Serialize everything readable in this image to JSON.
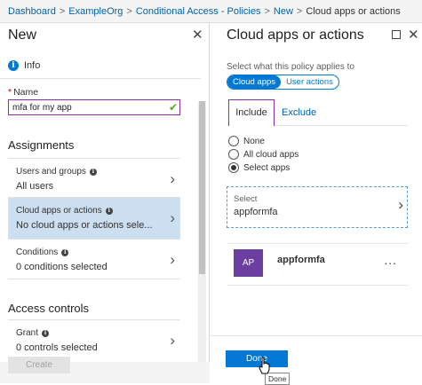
{
  "breadcrumb": [
    "Dashboard",
    "ExampleOrg",
    "Conditional Access - Policies",
    "New",
    "Cloud apps or actions"
  ],
  "left_blade": {
    "title": "New",
    "info_label": "Info",
    "name_label": "Name",
    "name_value": "mfa for my app",
    "assignments_heading": "Assignments",
    "items": [
      {
        "label": "Users and groups",
        "value": "All users"
      },
      {
        "label": "Cloud apps or actions",
        "value": "No cloud apps or actions sele..."
      },
      {
        "label": "Conditions",
        "value": "0 conditions selected"
      }
    ],
    "access_heading": "Access controls",
    "grant": {
      "label": "Grant",
      "value": "0 controls selected"
    },
    "create_label": "Create"
  },
  "right_blade": {
    "title": "Cloud apps or actions",
    "applies_text": "Select what this policy applies to",
    "toggle": [
      "Cloud apps",
      "User actions"
    ],
    "tabs": [
      "Include",
      "Exclude"
    ],
    "radios": [
      "None",
      "All cloud apps",
      "Select apps"
    ],
    "select_label": "Select",
    "select_value": "appformfa",
    "app": {
      "initials": "AP",
      "name": "appformfa",
      "more": "..."
    },
    "done_label": "Done",
    "tooltip": "Done"
  },
  "colors": {
    "accent": "#0078d4",
    "selected_bg": "#ccdff0",
    "avatar": "#6b3fa0"
  }
}
